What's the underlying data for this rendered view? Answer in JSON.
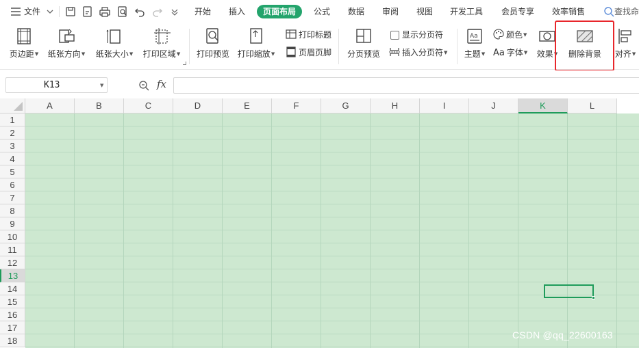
{
  "menubar": {
    "file_label": "文件",
    "tabs": [
      "开始",
      "插入",
      "页面布局",
      "公式",
      "数据",
      "审阅",
      "视图",
      "开发工具",
      "会员专享",
      "效率销售"
    ],
    "active_tab": "页面布局",
    "search_label": "查找命"
  },
  "ribbon": {
    "margins": "页边距",
    "orientation": "纸张方向",
    "paper_size": "纸张大小",
    "print_area": "打印区域",
    "print_preview": "打印预览",
    "print_scale": "打印缩放",
    "print_titles": "打印标题",
    "header_footer": "页眉页脚",
    "page_break_preview": "分页预览",
    "show_page_breaks": "显示分页符",
    "insert_page_break": "插入分页符",
    "theme": "主题",
    "colors": "颜色",
    "fonts": "字体",
    "fonts_prefix": "Aa",
    "effects": "效果",
    "delete_background": "删除背景",
    "align": "对齐"
  },
  "formula_bar": {
    "name_box": "K13",
    "fx": "fx",
    "formula": ""
  },
  "grid": {
    "columns": [
      "A",
      "B",
      "C",
      "D",
      "E",
      "F",
      "G",
      "H",
      "I",
      "J",
      "K",
      "L"
    ],
    "rows": [
      "1",
      "2",
      "3",
      "4",
      "5",
      "6",
      "7",
      "8",
      "9",
      "10",
      "11",
      "12",
      "13",
      "14",
      "15",
      "16",
      "17",
      "18"
    ],
    "active_column": "K",
    "active_row": "13",
    "background_color": "#cde8d0",
    "selection_color": "#1e9b5a"
  },
  "colors": {
    "accent": "#23a46c",
    "highlight_box": "#e8262b"
  },
  "watermark": "CSDN @qq_22600163"
}
